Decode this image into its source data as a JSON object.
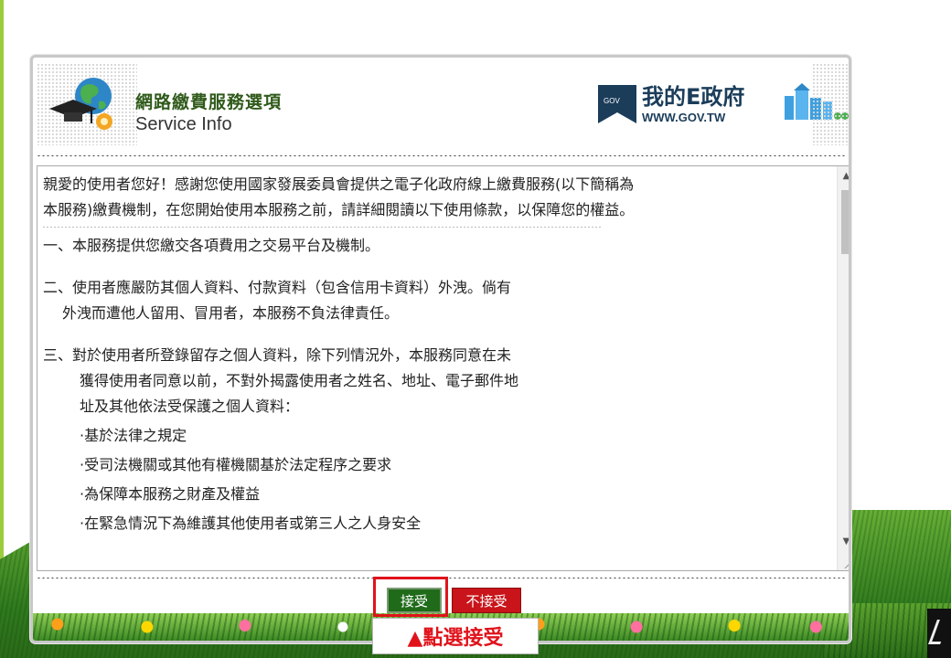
{
  "header": {
    "title_zh": "網路繳費服務選項",
    "title_en": "Service Info",
    "logo_name": "我的E政府",
    "logo_url": "WWW.GOV.TW",
    "logo_badge": "GOV"
  },
  "terms": {
    "intro_line1": "親愛的使用者您好！感謝您使用國家發展委員會提供之電子化政府線上繳費服務(以下簡稱為",
    "intro_line2": "本服務)繳費機制，在您開始使用本服務之前，請詳細閱讀以下使用條款，以保障您的權益。",
    "item1": "一、本服務提供您繳交各項費用之交易平台及機制。",
    "item2_line1": "二、使用者應嚴防其個人資料、付款資料（包含信用卡資料）外洩。倘有",
    "item2_line2": "外洩而遭他人留用、冒用者，本服務不負法律責任。",
    "item3_line1": "三、對於使用者所登錄留存之個人資料，除下列情況外，本服務同意在未",
    "item3_line2": "獲得使用者同意以前，不對外揭露使用者之姓名、地址、電子郵件地",
    "item3_line3": "址及其他依法受保護之個人資料：",
    "item3_sub": [
      "·基於法律之規定",
      "·受司法機關或其他有權機關基於法定程序之要求",
      "·為保障本服務之財產及權益",
      "·在緊急情況下為維護其他使用者或第三人之人身安全"
    ]
  },
  "buttons": {
    "accept": "接受",
    "decline": "不接受"
  },
  "hint": "▲點選接受",
  "colors": {
    "accept_bg": "#1f6b1a",
    "decline_bg": "#c8141a",
    "highlight": "#e0131b",
    "title_green": "#2f5a1a"
  },
  "icons": {
    "globe": "globe-graduation-cap-icon",
    "scroll_up": "scroll-up-arrow-icon",
    "scroll_down": "scroll-down-arrow-icon"
  }
}
